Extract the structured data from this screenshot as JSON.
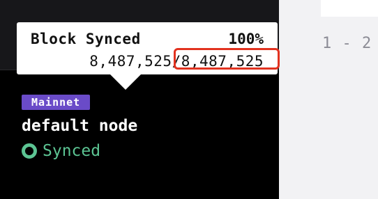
{
  "tooltip": {
    "title": "Block Synced",
    "percent": "100%",
    "blocks": "8,487,525/8,487,525"
  },
  "node": {
    "network": "Mainnet",
    "name": "default node",
    "status": "Synced",
    "status_color": "#5cc493",
    "network_color": "#6a4bc8"
  },
  "pagination": {
    "text": "1 - 2"
  },
  "colors": {
    "highlight": "#e2321f"
  }
}
